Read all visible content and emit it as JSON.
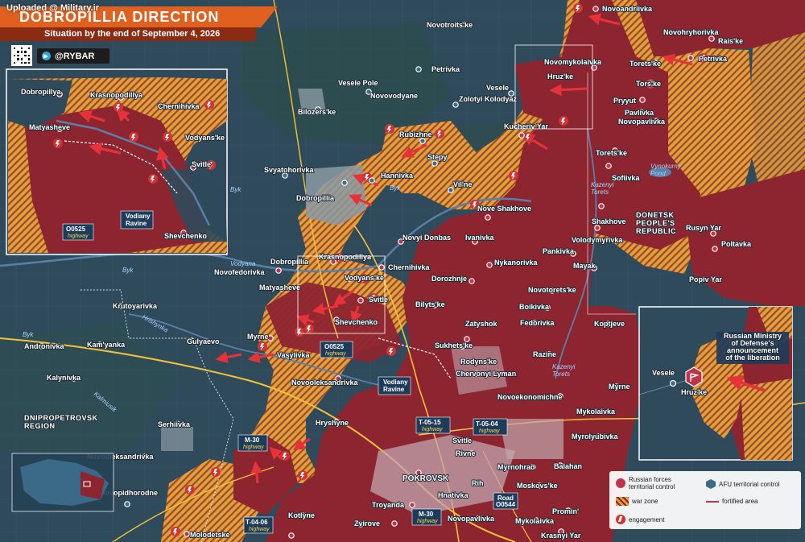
{
  "watermark": "Uploaded @ Military.ir",
  "header": {
    "title": "DOBROPILLIA DIRECTION",
    "subtitle": "Situation by the end of September 4, 2026",
    "brand": "@RYBAR",
    "accent_color": "#e0611f",
    "accent_dark": "#8a2b12"
  },
  "colors": {
    "russian_control": "#8d2530",
    "war_zone_orange": "#e1a03a",
    "afu_territory": "#2f4a5a",
    "engagement": "#d23333",
    "rivers": "#5b7fa8"
  },
  "towns": {
    "novoandriivka": "Novoandriivka",
    "novohryhorivka": "Novohryhorivka",
    "novotroitske": "Novotroits'ke",
    "raiske": "Rais'ke",
    "novomykolaivka": "Novomykolaivka",
    "petrivka_n": "Petrivka",
    "petrivka_e": "Petrivka",
    "toretske_ne": "Torets'ke",
    "vesele_pole": "Vesele Pole",
    "novovodyane": "Novovodyane",
    "vesele": "Vesele",
    "hruzke": "Hruz'ke",
    "torske": "Tors'ke",
    "zolotyi_kolodyaz": "Zolotyi Kolodyaz",
    "pryyut": "Pryyut",
    "bilozerske": "Bilozers'ke",
    "pavlivka": "Pavlivka",
    "novopavlivka_n": "Novopavlivka",
    "kucheriv_yar": "Kucheriv Yar",
    "rubizhne": "Rubizhne",
    "toretske": "Torets'ke",
    "stepy": "Stepy",
    "sofiivka": "Sofiivka",
    "svyatohorivka": "Svyatohorivka",
    "hannivka": "Hannivka",
    "vilne": "Vil'ne",
    "dobropillia": "Dobropillia",
    "nove_shakhove": "Nove Shakhove",
    "shakhove": "Shakhove",
    "novyi_donbas": "Novyi Donbas",
    "ivanivka": "Ivanivka",
    "volodymyrivka": "Volodymyrivka",
    "rusyn_yar": "Rusyn Yar",
    "poltavka": "Poltavka",
    "pankivka": "Pankivka",
    "krasnopodillya": "Krasnopodillya",
    "nykanorivka": "Nykanorivka",
    "mayak": "Mayak",
    "novofedorivka": "Novofedorivka",
    "chernihivka": "Chernihivka",
    "vodyanske": "Vodyans'ke",
    "dorozhnje": "Dorozhnje",
    "popiv_yar": "Popiv Yar",
    "matyasheve": "Matyasheve",
    "novotoretske": "Novotorets'ke",
    "krutoyarivka": "Krutoyarivka",
    "svitle_n": "Svitle",
    "bilytske": "Bilyts'ke",
    "boikivka": "Boikivka",
    "koptjeve": "Koptjeve",
    "shevchenko": "Shevchenko",
    "zatyshok": "Zatyshok",
    "fedorivka": "Fedorivka",
    "andronivka": "Andronivka",
    "gulyaevo": "Gulyaevo",
    "myrne_w": "Myrne",
    "kamyanka": "Kam'yanka",
    "vasylivka": "Vasylivka",
    "sukhetske": "Sukhets'ke",
    "rodynske": "Rodyns'ke",
    "razine": "Razine",
    "chervonyi_lyman": "Chervonyi Lyman",
    "kalynivka": "Kalynivka",
    "novooleksandrivka_n": "Novooleksandrivka",
    "novoekonomichne": "Novoekonomichne",
    "myrne_e": "Myrne",
    "hryshyne": "Hryshyne",
    "mykolaivka": "Mykolaivka",
    "serhiivka": "Serhiivka",
    "svitle_s": "Svitle",
    "myrolyubivka": "Myrolyubivka",
    "rivne": "Rivne",
    "novooleksandrivka_s": "Novooleksandrivka",
    "myrnohrad": "Myrnohrad",
    "balahan": "Balahan",
    "pokrovsk": "POKROVSK",
    "rih": "Rih",
    "moskovske": "Moskovs'ke",
    "hnativka": "Hnativka",
    "novopidhorodne": "Novopidhorodne",
    "troyanda": "Troyanda",
    "promin": "Promin'",
    "kotlyne": "Kotlyne",
    "zvirove": "Zvirove",
    "novopavlivka_s": "Novopavlivka",
    "mykolaivka_s": "Mykolaivka",
    "molodetske": "Molodetske",
    "krasnyi_yar": "Krasnyi Yar"
  },
  "water": {
    "byk_center": "Byk",
    "byk_west": "Byk",
    "byk_nw": "Byk",
    "vodyana": "Vodyana",
    "hrishynka": "Hrishynka",
    "kazennyi_torets_n": "Kazenyi\nTorets",
    "kazennyi_torets_s": "Kazenyi\nTorets",
    "kalmiusik": "Kalmiusik",
    "vynokurny_pond": "Vynokurny\nPond"
  },
  "regions": {
    "donetsk": "DONETSK\nPEOPLE'S\nREPUBLIC",
    "dnipropetrovsk": "DNIPROPETROVSK\nREGION"
  },
  "road_tags": {
    "o0525_main": {
      "code": "O0525",
      "type": "highway"
    },
    "vodiany_ravine_main": {
      "name": "Vodiany\nRavine"
    },
    "t0515": {
      "code": "T-05-15",
      "type": "highway"
    },
    "t0504": {
      "code": "T-05-04",
      "type": "highway"
    },
    "m30_w": {
      "code": "M-30",
      "type": "highway"
    },
    "m30_s": {
      "code": "M-30",
      "type": "highway"
    },
    "road_o0544": {
      "code": "Road\nO0544"
    },
    "t0406": {
      "code": "T-04-06",
      "type": "highway"
    }
  },
  "inset_left": {
    "towns": {
      "dobropillya": "Dobropillya",
      "krasnopodillya": "Krasnopodillya",
      "chernihivka": "Chernihivka",
      "matyasheve": "Matyasheve",
      "vodyanske": "Vodyans'ke",
      "svitle": "Svitle",
      "shevchenko": "Shevchenko"
    },
    "o0525_code": "O0525",
    "o0525_type": "highway",
    "ravine": "Vodiany\nRavine"
  },
  "inset_right": {
    "towns": {
      "vesele": "Vesele",
      "hruzke": "Hruz'ke"
    },
    "annotation": "Russian Ministry\nof Defense's\nannouncement\nof the liberation"
  },
  "legend": {
    "russian": "Russian forces\nterritorial control",
    "afu": "AFU territorial control",
    "war_zone": "war zone",
    "fortified": "fortified area",
    "engagement": "engagement"
  }
}
